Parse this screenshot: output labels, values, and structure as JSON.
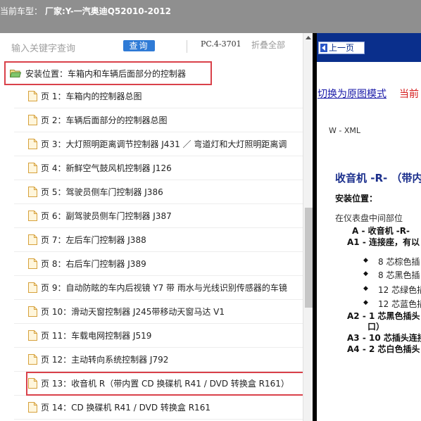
{
  "titlebar": {
    "label": "当前车型：",
    "value": "厂家:Y-一汽奥迪Q52010-2012"
  },
  "toolbar": {
    "search_placeholder": "输入关键字查询",
    "query_label": "查询",
    "pc_code": "PC.4-3701",
    "collapse_all": "折叠全部"
  },
  "tree": {
    "root_label": "安装位置：车箱内和车辆后面部分的控制器",
    "items": [
      "页 1：车箱内的控制器总图",
      "页 2：车辆后面部分的控制器总图",
      "页 3：大灯照明距离调节控制器 J431 ／ 弯道灯和大灯照明距离调",
      "页 4：新鲜空气鼓风机控制器 J126",
      "页 5：驾驶员侧车门控制器 J386",
      "页 6：副驾驶员侧车门控制器 J387",
      "页 7：左后车门控制器 J388",
      "页 8：右后车门控制器 J389",
      "页 9：自动防眩的车内后视镜 Y7 带 雨水与光线识别传感器的车镜",
      "页 10：滑动天窗控制器 J245带移动天窗马达 V1",
      "页 11：车载电网控制器 J519",
      "页 12：主动转向系统控制器 J792",
      "页 13：收音机 R（带内置 CD 换碟机 R41 / DVD 转换盒 R161）",
      "页 14：CD 换碟机 R41 / DVD 转换盒 R161"
    ]
  },
  "viewer": {
    "prev_label": "上一页",
    "switch_link": "切换为原图模式",
    "current_tag": "当前",
    "doc_code": "W - XML",
    "doc_title": "收音机 -R- （带内",
    "install_label": "安装位置：",
    "install_location": "在仪表盘中间部位",
    "lines": [
      "A - 收音机 -R-",
      "A1 - 连接座，有以"
    ],
    "bullets": [
      "8 芯棕色插",
      "8 芯黑色插",
      "12 芯绿色插",
      "12 芯蓝色插"
    ],
    "lines2": [
      "A2 - 1 芯黑色插头",
      "口）",
      "A3 - 10 芯插头连接",
      "A4 - 2 芯白色插头"
    ]
  }
}
